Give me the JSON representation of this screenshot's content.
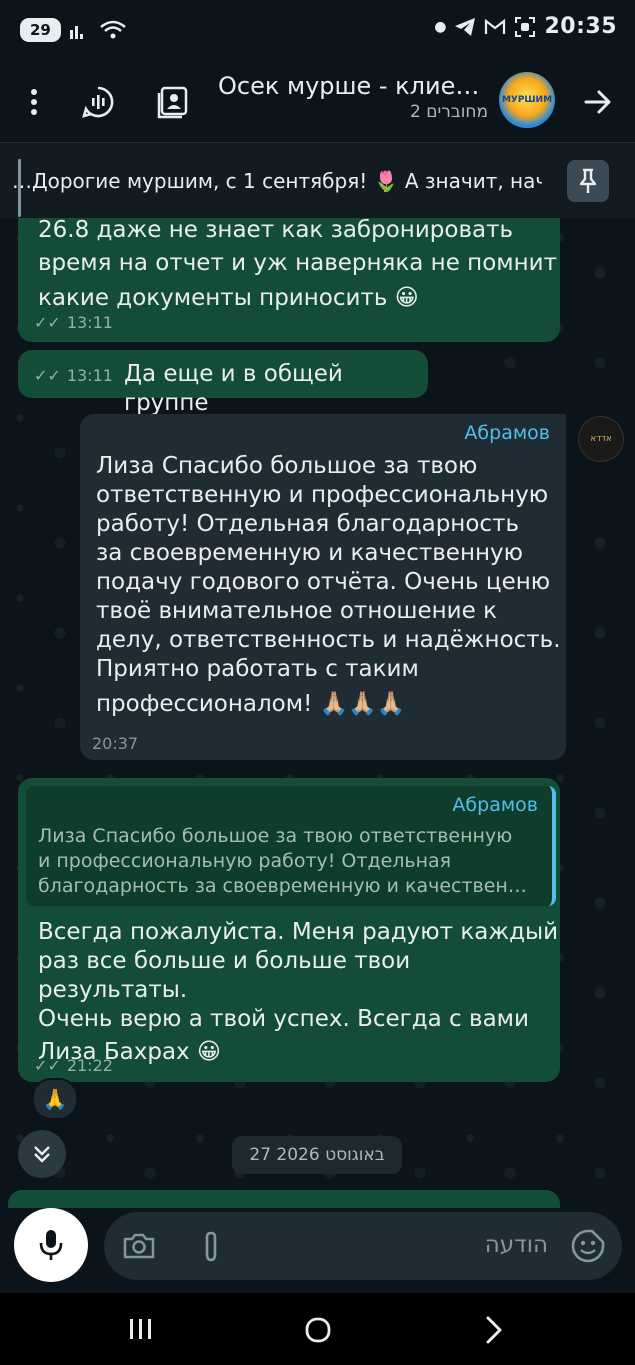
{
  "status": {
    "battery": "29",
    "time": "20:35",
    "wifi_badge": "5"
  },
  "header": {
    "title": "Осек мурше - клиен…",
    "subtitle": "2 מחוברים",
    "avatar_text": "МУРШИМ"
  },
  "pinned": {
    "text": "…Дорогие муршим, с 1 сентября! 🌷  А значит, нач"
  },
  "messages": {
    "m1": {
      "text_lines": [
        "26.8 даже не знает как забронировать",
        "время на отчет и уж наверняка не помнит",
        "какие документы приносить 😀"
      ],
      "time": "13:11"
    },
    "m2": {
      "text": "Да еще и в общей группе",
      "time": "13:11"
    },
    "m3": {
      "sender": "Абрамов",
      "text_lines": [
        "Лиза Спасибо большое за твою",
        "ответственную и профессиональную",
        "работу! Отдельная благодарность",
        "за своевременную и качественную",
        "подачу годового отчёта. Очень ценю",
        "твоё внимательное отношение к",
        "делу, ответственность и надёжность.",
        "Приятно работать с таким",
        "профессионалом! 🙏🏼🙏🏼🙏🏼"
      ],
      "time": "20:37",
      "avatar_text": "אדדא"
    },
    "m4": {
      "quote_sender": "Абрамов",
      "quote_lines": [
        "Лиза Спасибо большое за твою ответственную",
        "и профессиональную работу! Отдельная",
        "благодарность за своевременную и качествен…"
      ],
      "text_lines": [
        "Всегда пожалуйста.  Меня радуют каждый",
        "раз все больше и больше твои результаты.",
        "Очень верю а твой успех. Всегда с вами",
        "Лиза Бахрах 😀"
      ],
      "time": "21:22",
      "reaction": "🙏"
    }
  },
  "date_separator": "27 באוגוסט 2026",
  "composer": {
    "placeholder": "הודעה"
  },
  "colors": {
    "outgoing": "#144d37",
    "incoming": "#202c33",
    "accent": "#53bdeb",
    "background": "#0b141a"
  }
}
